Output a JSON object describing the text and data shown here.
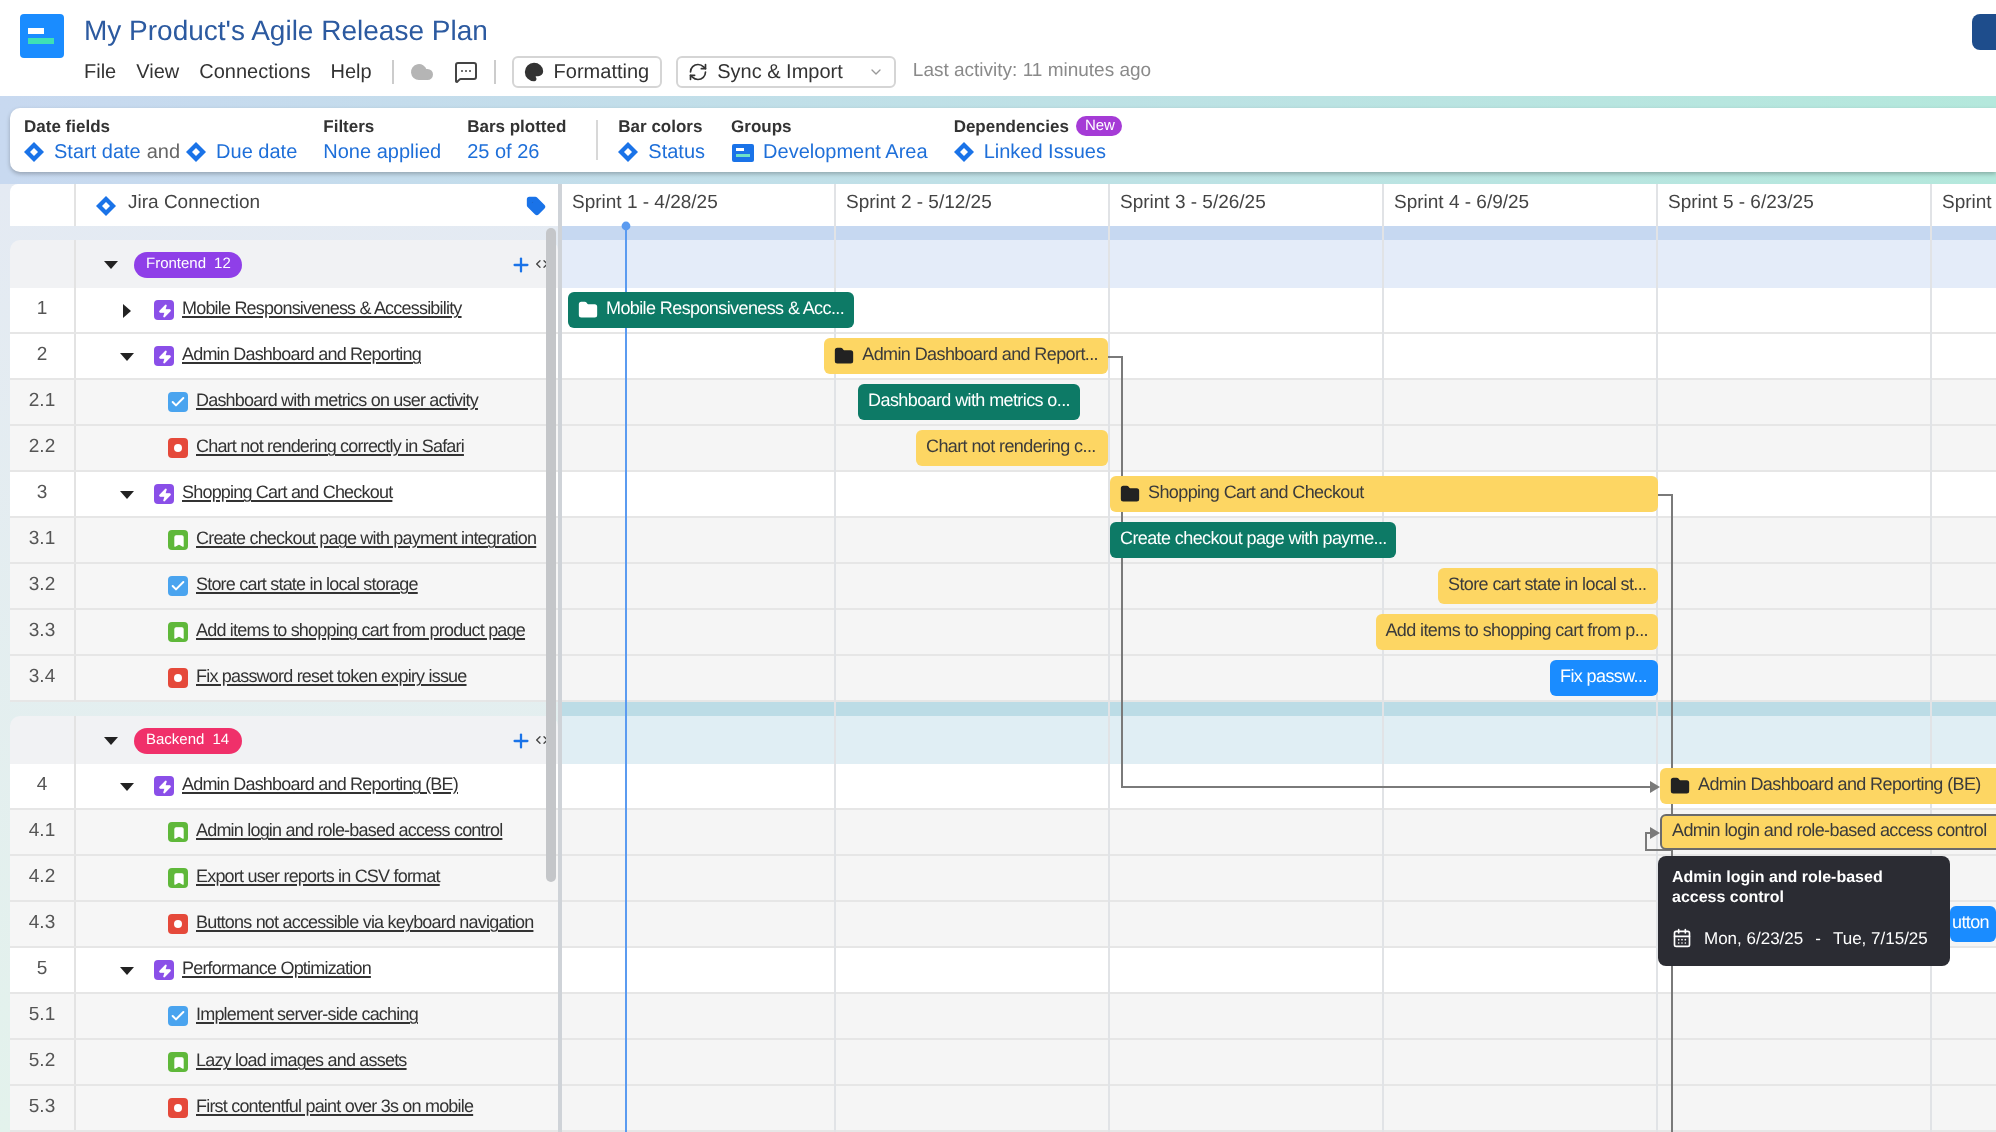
{
  "app": {
    "title": "My Product's Agile Release Plan",
    "menu": [
      "File",
      "View",
      "Connections",
      "Help"
    ],
    "formatting": "Formatting",
    "sync": "Sync & Import",
    "activity_label": "Last activity:",
    "activity_value": "11 minutes ago"
  },
  "settings": [
    {
      "label": "Date fields",
      "separated": false,
      "items": [
        {
          "kind": "field",
          "text": "Start date"
        },
        {
          "kind": "plain",
          "text": "and"
        },
        {
          "kind": "field",
          "text": "Due date"
        }
      ]
    },
    {
      "label": "Filters",
      "separated": false,
      "items": [
        {
          "kind": "link",
          "text": "None applied"
        }
      ]
    },
    {
      "label": "Bars plotted",
      "separated": false,
      "items": [
        {
          "kind": "link",
          "text": "25 of 26"
        }
      ]
    },
    {
      "label": "Bar colors",
      "separated": true,
      "items": [
        {
          "kind": "field",
          "text": "Status"
        }
      ]
    },
    {
      "label": "Groups",
      "separated": false,
      "items": [
        {
          "kind": "group",
          "text": "Development Area"
        }
      ]
    },
    {
      "label": "Dependencies",
      "badge": "New",
      "separated": false,
      "items": [
        {
          "kind": "field",
          "text": "Linked Issues"
        }
      ]
    }
  ],
  "grid": {
    "connection": "Jira Connection",
    "columns": [
      "Sprint 1 - 4/28/25",
      "Sprint 2 - 5/12/25",
      "Sprint 3 - 5/26/25",
      "Sprint 4 - 6/9/25",
      "Sprint 5 - 6/23/25",
      "Sprint"
    ]
  },
  "groups": [
    {
      "name": "Frontend",
      "count": "12",
      "color": "#8f3fe8",
      "expanded": true,
      "rows": [
        {
          "number": "1",
          "kind": "epic",
          "expanded": false,
          "title": "Mobile Responsiveness & Accessibility",
          "bar": {
            "label": "Mobile Responsiveness & Acc...",
            "color": "#0d7a66",
            "selected": false
          }
        },
        {
          "number": "2",
          "kind": "epic",
          "expanded": true,
          "title": "Admin Dashboard and Reporting",
          "bar": {
            "label": "Admin Dashboard and Report...",
            "color": "#fdd663",
            "selected": false
          }
        },
        {
          "number": "2.1",
          "kind": "task",
          "title": "Dashboard with metrics on user activity",
          "bar": {
            "label": "Dashboard with metrics o...",
            "color": "#0d7a66",
            "selected": false
          }
        },
        {
          "number": "2.2",
          "kind": "bug",
          "title": "Chart not rendering correctly in Safari",
          "bar": {
            "label": "Chart not rendering c...",
            "color": "#fdd663",
            "selected": false
          }
        },
        {
          "number": "3",
          "kind": "epic",
          "expanded": true,
          "title": "Shopping Cart and Checkout",
          "bar": {
            "label": "Shopping Cart and Checkout",
            "color": "#fdd663",
            "selected": false
          }
        },
        {
          "number": "3.1",
          "kind": "story",
          "title": "Create checkout page with payment integration",
          "bar": {
            "label": "Create checkout page with payme...",
            "color": "#0d7a66",
            "selected": false
          }
        },
        {
          "number": "3.2",
          "kind": "task",
          "title": "Store cart state in local storage",
          "bar": {
            "label": "Store cart state in local st...",
            "color": "#fdd663",
            "selected": false
          }
        },
        {
          "number": "3.3",
          "kind": "story",
          "title": "Add items to shopping cart from product page",
          "bar": {
            "label": "Add items to shopping cart from p...",
            "color": "#fdd663",
            "selected": false
          }
        },
        {
          "number": "3.4",
          "kind": "bug",
          "title": "Fix password reset token expiry issue",
          "bar": {
            "label": "Fix passw...",
            "color": "#1a8cff",
            "selected": false
          }
        }
      ]
    },
    {
      "name": "Backend",
      "count": "14",
      "color": "#f0306a",
      "expanded": true,
      "rows": [
        {
          "number": "4",
          "kind": "epic",
          "expanded": true,
          "title": "Admin Dashboard and Reporting (BE)",
          "bar": {
            "label": "Admin Dashboard and Reporting (BE)",
            "color": "#fdd663",
            "selected": false
          }
        },
        {
          "number": "4.1",
          "kind": "story",
          "title": "Admin login and role-based access control",
          "bar": {
            "label": "Admin login and role-based access control",
            "color": "#fdd663",
            "selected": true
          }
        },
        {
          "number": "4.2",
          "kind": "story",
          "title": "Export user reports in CSV format"
        },
        {
          "number": "4.3",
          "kind": "bug",
          "title": "Buttons not accessible via keyboard navigation",
          "bar": {
            "label": "utton",
            "color": "#1a8cff",
            "selected": false
          }
        },
        {
          "number": "5",
          "kind": "epic",
          "expanded": true,
          "title": "Performance Optimization"
        },
        {
          "number": "5.1",
          "kind": "task",
          "title": "Implement server-side caching"
        },
        {
          "number": "5.2",
          "kind": "story",
          "title": "Lazy load images and assets"
        },
        {
          "number": "5.3",
          "kind": "bug",
          "title": "First contentful paint over 3s on mobile"
        }
      ]
    }
  ],
  "tooltip": {
    "title": "Admin login and role-based access control",
    "start": "Mon, 6/23/25",
    "separator": "-",
    "end": "Tue, 7/15/25"
  }
}
